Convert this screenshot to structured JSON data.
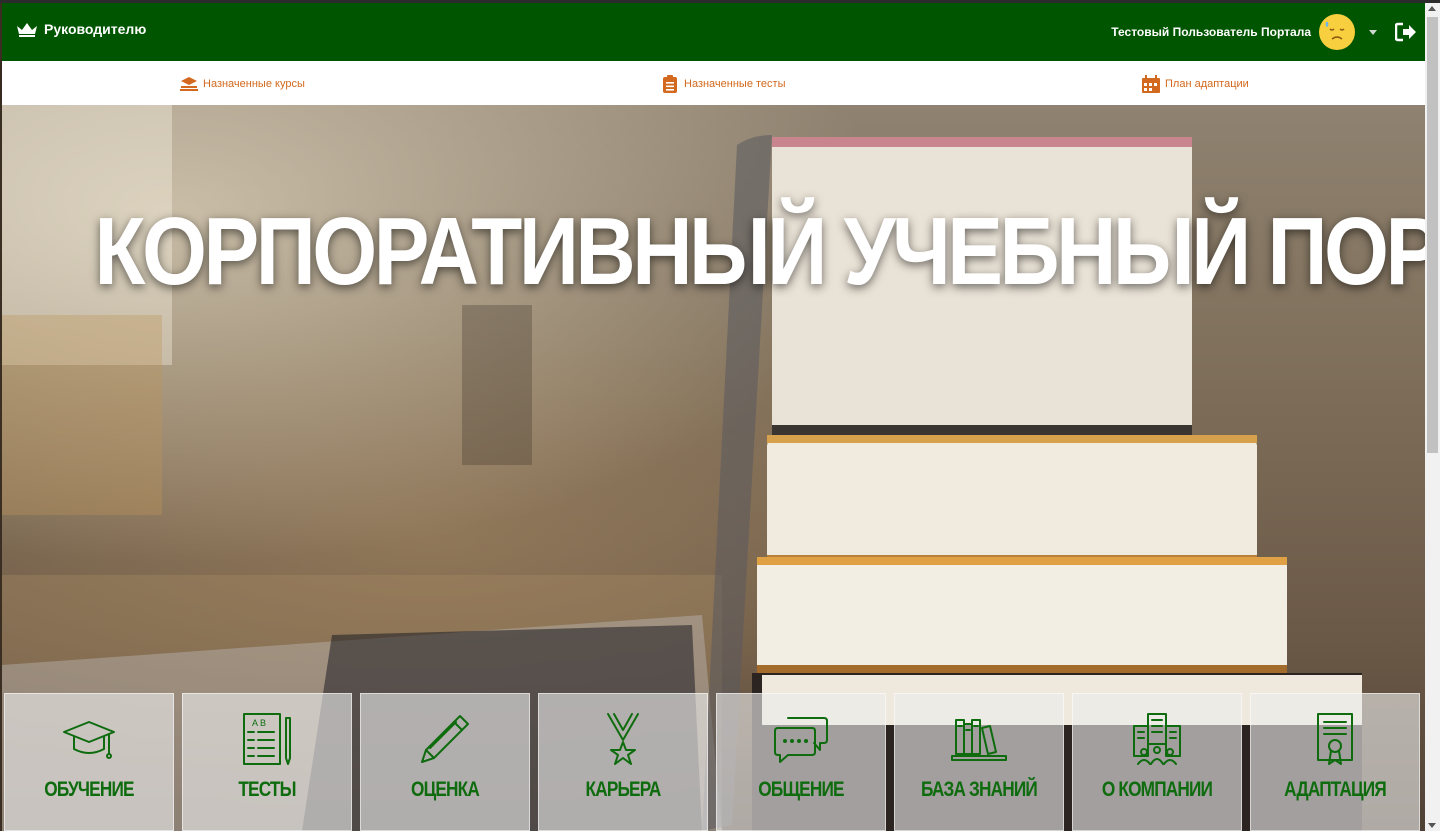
{
  "header": {
    "brand_label": "Руководителю",
    "user_name": "Тестовый Пользователь Портала",
    "bg_color": "#005500"
  },
  "subnav": {
    "items": [
      {
        "label": "Назначенные курсы",
        "icon": "graduation-books-icon"
      },
      {
        "label": "Назначенные тесты",
        "icon": "clipboard-list-icon"
      },
      {
        "label": "План адаптации",
        "icon": "calendar-icon"
      }
    ],
    "accent_color": "#d2691e"
  },
  "hero": {
    "title": "КОРПОРАТИВНЫЙ УЧЕБНЫЙ ПОРТАЛ"
  },
  "tiles": [
    {
      "label": "ОБУЧЕНИЕ",
      "icon": "graduation-cap-icon"
    },
    {
      "label": "ТЕСТЫ",
      "icon": "test-sheet-icon"
    },
    {
      "label": "ОЦЕНКА",
      "icon": "pencil-icon"
    },
    {
      "label": "КАРЬЕРА",
      "icon": "medal-icon"
    },
    {
      "label": "ОБЩЕНИЕ",
      "icon": "chat-bubbles-icon"
    },
    {
      "label": "БАЗА ЗНАНИЙ",
      "icon": "books-shelf-icon"
    },
    {
      "label": "О КОМПАНИИ",
      "icon": "company-building-icon"
    },
    {
      "label": "АДАПТАЦИЯ",
      "icon": "certificate-icon"
    }
  ],
  "tile_label_color": "#0e6b0e"
}
